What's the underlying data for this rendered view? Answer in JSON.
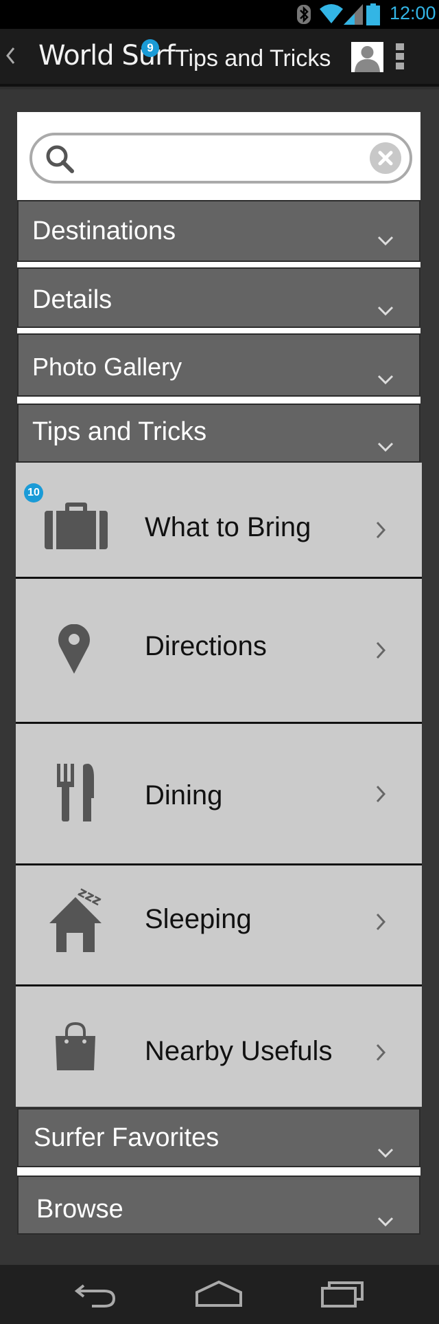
{
  "status_bar": {
    "time": "12:00",
    "accent": "#33b5e5"
  },
  "action_bar": {
    "app_title": "World Surf",
    "badge": "9",
    "page_title": "Tips and Tricks",
    "icons": [
      "back-chevron-icon",
      "user-avatar-icon",
      "overflow-menu-icon"
    ]
  },
  "search": {
    "placeholder": "",
    "value": ""
  },
  "sections": [
    {
      "label": "Destinations",
      "expanded": false
    },
    {
      "label": "Details",
      "expanded": false
    },
    {
      "label": "Photo Gallery",
      "expanded": false
    },
    {
      "label": "Tips and Tricks",
      "expanded": true
    },
    {
      "label": "Surfer Favorites",
      "expanded": false
    },
    {
      "label": "Browse",
      "expanded": false
    }
  ],
  "tips_items": [
    {
      "label": "What to Bring",
      "icon": "suitcase-icon",
      "badge": "10"
    },
    {
      "label": "Directions",
      "icon": "map-pin-icon"
    },
    {
      "label": "Dining",
      "icon": "fork-knife-icon"
    },
    {
      "label": "Sleeping",
      "icon": "house-zzz-icon"
    },
    {
      "label": "Nearby Usefuls",
      "icon": "shopping-bag-icon"
    }
  ],
  "nav_bar": {
    "icons": [
      "back-nav-icon",
      "home-nav-icon",
      "recent-apps-icon"
    ]
  },
  "colors": {
    "badge_blue": "#1a9bd7",
    "section_grey": "#646464",
    "item_grey": "#cbcbcb"
  }
}
